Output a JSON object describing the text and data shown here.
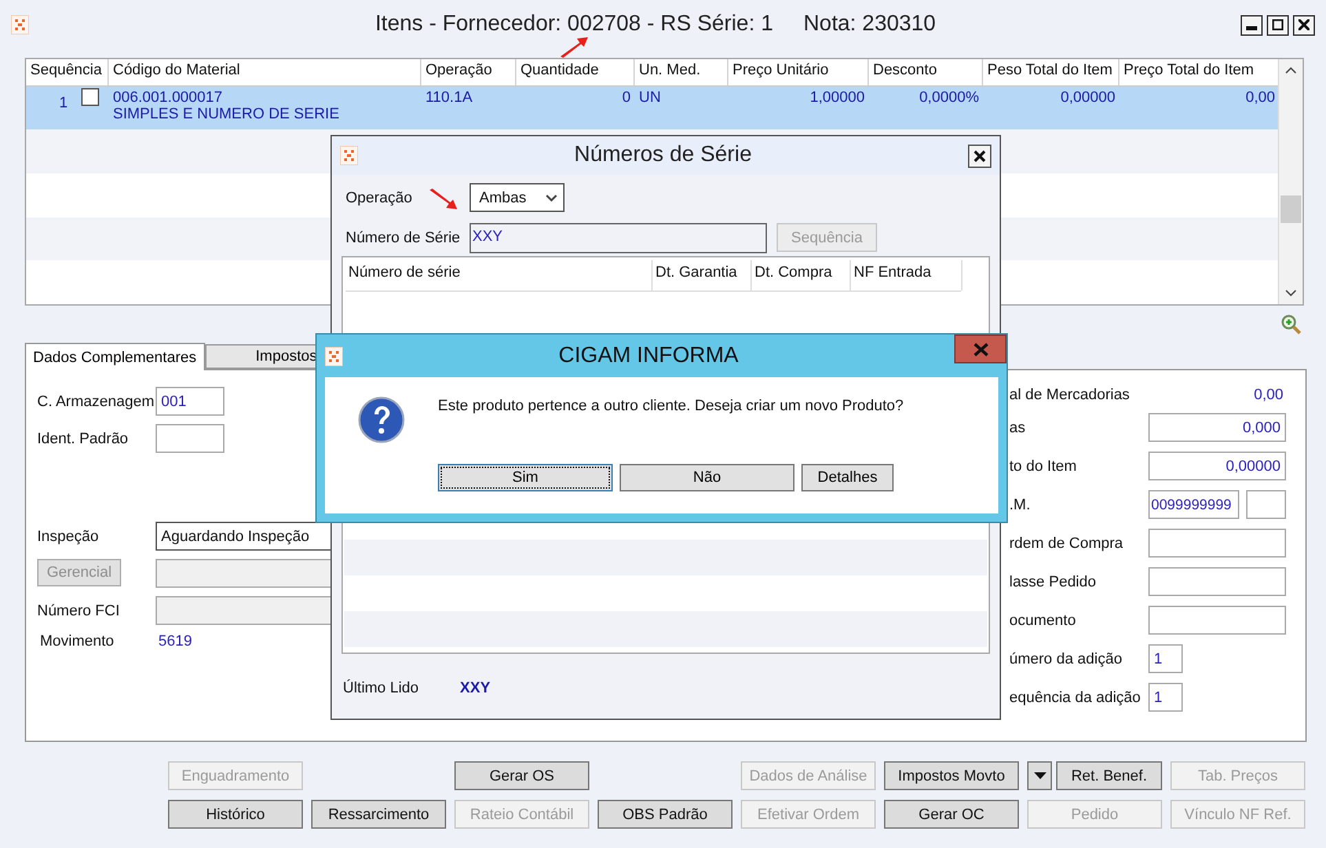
{
  "window": {
    "title": "Itens - Fornecedor: 002708 - RS Série: 1",
    "subtitle": "Nota: 230310"
  },
  "items_table": {
    "columns": [
      "Sequência",
      "Código do Material",
      "Operação",
      "Quantidade",
      "Un. Med.",
      "Preço Unitário",
      "Desconto",
      "Peso Total do Item",
      "Preço Total do Item"
    ],
    "rows": [
      {
        "selected": true,
        "checked": false,
        "sequence": "1",
        "code": "006.001.000017",
        "description": "SIMPLES E NUMERO DE SERIE",
        "operation": "110.1A",
        "quantity": "0",
        "unit": "UN",
        "unit_price": "1,00000",
        "discount": "0,0000%",
        "weight": "0,00000",
        "total": "0,00"
      }
    ]
  },
  "tabs": [
    {
      "label": "Dados Complementares",
      "selected": true
    },
    {
      "label": "Impostos",
      "selected": false
    }
  ],
  "left_fields": {
    "storage_label": "C. Armazenagem",
    "storage_value": "001",
    "ident_label": "Ident. Padrão",
    "inspection_label": "Inspeção",
    "inspection_value": "Aguardando Inspeção",
    "manager_button": {
      "label": "Gerencial",
      "disabled": true
    },
    "fci_label": "Número FCI",
    "movement_label": "Movimento",
    "movement_value": "5619"
  },
  "right_fields": [
    {
      "kind": "value",
      "label": "al de Mercadorias",
      "value": "0,00"
    },
    {
      "kind": "input",
      "label": "as",
      "value": "0,000"
    },
    {
      "kind": "input",
      "label": "to do Item",
      "value": "0,00000"
    },
    {
      "kind": "pair",
      "label": ".M.",
      "value": "0099999999"
    },
    {
      "kind": "input",
      "label": "rdem de Compra"
    },
    {
      "kind": "input",
      "label": "lasse Pedido"
    },
    {
      "kind": "input",
      "label": "ocumento"
    },
    {
      "kind": "short",
      "label": "úmero da adição",
      "value": "1"
    },
    {
      "kind": "short",
      "label": "equência da adição",
      "value": "1"
    }
  ],
  "buttons_row_1": [
    {
      "kind": "button",
      "label": "Enguadramento",
      "disabled": true
    },
    {
      "kind": "button",
      "label": "Gerar OS",
      "disabled": false
    },
    {
      "kind": "button",
      "label": "Dados de Análise",
      "disabled": true
    },
    {
      "kind": "button",
      "label": "Impostos Movto",
      "disabled": false
    },
    {
      "kind": "menu_arrow"
    },
    {
      "kind": "button",
      "label": "Ret. Benef.",
      "disabled": false
    },
    {
      "kind": "button",
      "label": "Tab. Preços",
      "disabled": true
    }
  ],
  "buttons_row_2": [
    {
      "label": "Histórico",
      "disabled": false
    },
    {
      "label": "Ressarcimento",
      "disabled": false
    },
    {
      "label": "Rateio Contábil",
      "disabled": true
    },
    {
      "label": "OBS Padrão",
      "disabled": false
    },
    {
      "label": "Efetivar Ordem",
      "disabled": true
    },
    {
      "label": "Gerar OC",
      "disabled": false
    },
    {
      "label": "Pedido",
      "disabled": true
    },
    {
      "label": "Vínculo NF Ref.",
      "disabled": true
    }
  ],
  "serial_dialog": {
    "title": "Números de Série",
    "operation_label": "Operação",
    "operation_value": "Ambas",
    "serial_label": "Número de Série",
    "serial_value": "XXY",
    "sequence_button": {
      "label": "Sequência",
      "disabled": true
    },
    "columns": [
      "Número de série",
      "Dt. Garantia",
      "Dt. Compra",
      "NF Entrada"
    ],
    "last_read_label": "Último Lido",
    "last_read_value": "XXY"
  },
  "message_dialog": {
    "title": "CIGAM INFORMA",
    "message": "Este produto pertence a outro cliente. Deseja criar um novo Produto?",
    "buttons": [
      {
        "label": "Sim",
        "focused": true
      },
      {
        "label": "Não",
        "focused": false
      },
      {
        "label": "Detalhes",
        "focused": false
      }
    ]
  }
}
